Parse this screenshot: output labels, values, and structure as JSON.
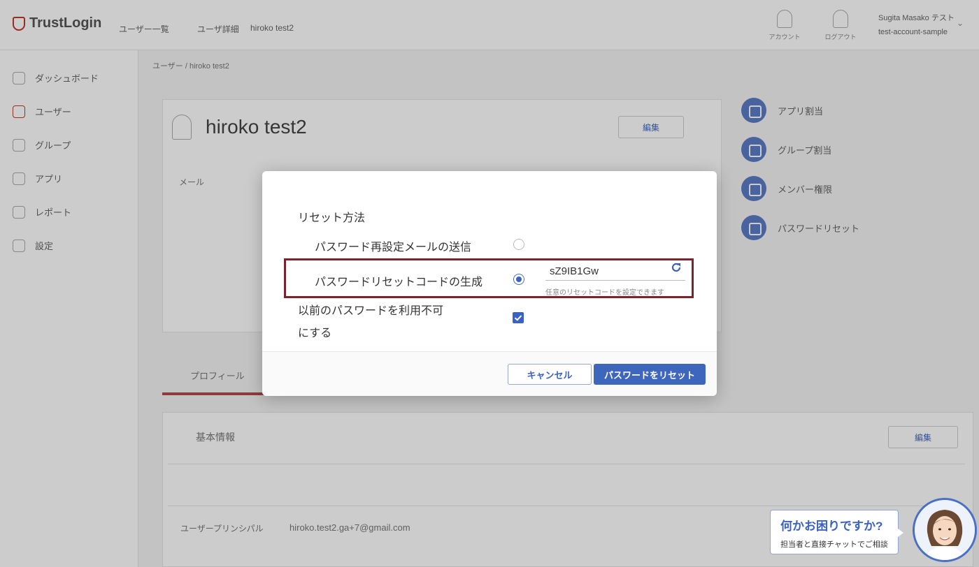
{
  "app": {
    "logo_text": "TrustLogin",
    "breadcrumb_top": [
      "ユーザー一覧",
      "ユーザ詳細",
      "hiroko test2"
    ],
    "top_icons": [
      {
        "name": "user-icon",
        "label": "アカウント"
      },
      {
        "name": "logout-icon",
        "label": "ログアウト"
      }
    ],
    "account": {
      "name": "Sugita Masako テスト",
      "id": "test-account-sample"
    }
  },
  "sidebar": {
    "items": [
      {
        "label": "ダッシュボード",
        "icon": "dashboard-icon"
      },
      {
        "label": "ユーザー",
        "icon": "users-icon"
      },
      {
        "label": "グループ",
        "icon": "group-icon"
      },
      {
        "label": "アプリ",
        "icon": "apps-icon"
      },
      {
        "label": "レポート",
        "icon": "report-icon"
      },
      {
        "label": "設定",
        "icon": "settings-icon"
      }
    ]
  },
  "main": {
    "breadcrumb": "ユーザー / hiroko test2",
    "user_name": "hiroko test2",
    "edit_label": "編集",
    "profile_tab": "プロフィール",
    "basic_info": "基本情報",
    "field_email_label": "メール",
    "field_user_label": "ユーザープリンシパル",
    "field_user_value": "hiroko.test2.ga+7@gmail.com",
    "right_links": [
      {
        "label": "アプリ割当",
        "icon": "app-assign-icon"
      },
      {
        "label": "グループ割当",
        "icon": "group-assign-icon"
      },
      {
        "label": "メンバー権限",
        "icon": "member-icon"
      },
      {
        "label": "パスワードリセット",
        "icon": "key-icon"
      }
    ]
  },
  "modal": {
    "section_title": "リセット方法",
    "option_email": "パスワード再設定メールの送信",
    "option_code": "パスワードリセットコードの生成",
    "selected_option": "code",
    "reset_code": "sZ9IB1Gw",
    "code_hint": "任意のリセットコードを設定できます",
    "prev_password_line1": "以前のパスワードを利用不可",
    "prev_password_line2": "にする",
    "prev_password_checked": true,
    "cancel_label": "キャンセル",
    "reset_label": "パスワードをリセット"
  },
  "chat": {
    "title": "何かお困りですか?",
    "subtitle": "担当者と直接チャットでご相談"
  },
  "colors": {
    "accent": "#3f66bd",
    "highlight_border": "#7a2430",
    "brand_red": "#c0392b"
  }
}
